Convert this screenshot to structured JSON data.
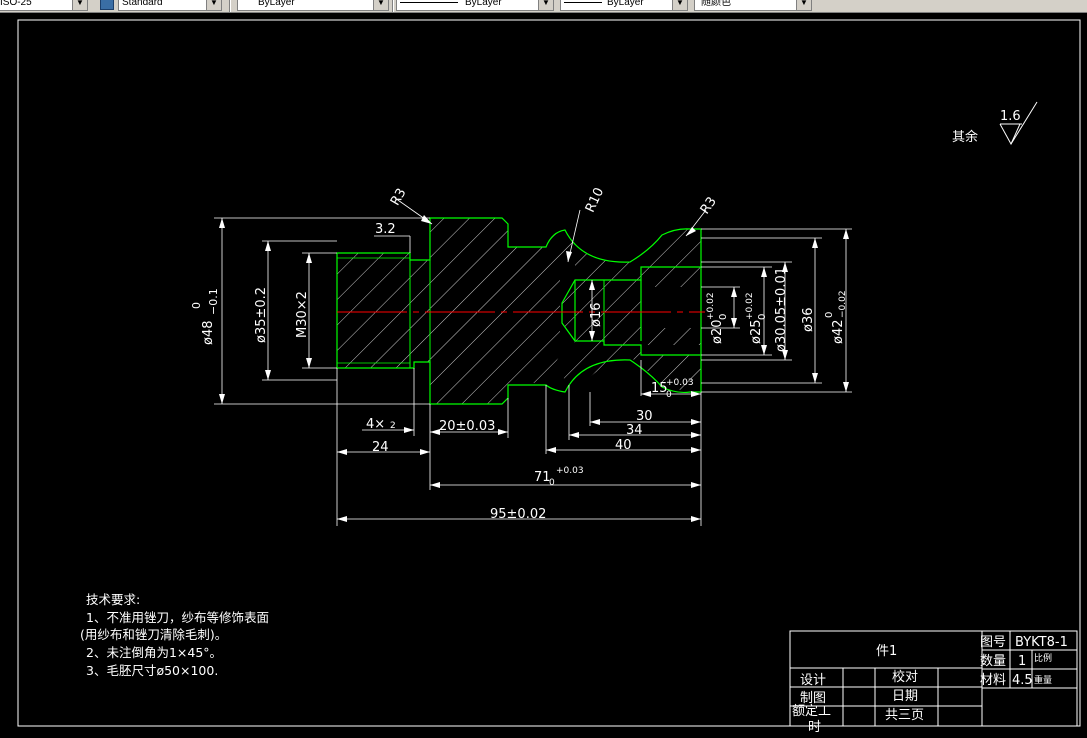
{
  "toolbar": {
    "dimstyle": "ISO-25",
    "textstyle": "Standard",
    "layer": "ByLayer",
    "linetype": "ByLayer",
    "lineweight": "ByLayer",
    "plotstyle": "随颜色"
  },
  "roughness": {
    "prefix": "其余",
    "value": "1.6"
  },
  "dimensions": {
    "r3a": "R3",
    "r10": "R10",
    "r3b": "R3",
    "r3_2": "3.2",
    "d48": "ø48",
    "d48_up": "0",
    "d48_low": "−0.1",
    "d35": "ø35±0.2",
    "m30": "M30×2",
    "d16": "ø16",
    "d20": "ø20",
    "d20_sub": "0",
    "d20_sup": "+0.02",
    "d25": "ø25",
    "d25_sub": "0",
    "d25_sup": "+0.02",
    "d30": "ø30.05±0.01",
    "d36": "ø36",
    "d42": "ø42",
    "d42_up": "0",
    "d42_low": "−0.02",
    "len15": "15",
    "len15_sub": "0",
    "len15_sup": "+0.03",
    "len30": "30",
    "len34": "34",
    "len40": "40",
    "groove": "4×",
    "groove_sub": "2",
    "len20": "20±0.03",
    "len24": "24",
    "len71": "71",
    "len71_sub": "0",
    "len71_sup": "+0.03",
    "len95": "95±0.02"
  },
  "tech": {
    "title": "技术要求:",
    "line1": "1、不准用锉刀，纱布等修饰表面",
    "line2": "(用纱布和锉刀清除毛刺)。",
    "line3": "2、未注倒角为1×45°。",
    "line4": "3、毛胚尺寸ø50×100."
  },
  "titleblock": {
    "part": "件1",
    "tuhao_label": "图号",
    "tuhao_value": "BYKT8-1",
    "qty_label": "数量",
    "qty_value": "1",
    "scale_label": "比例",
    "material_label": "材料",
    "material_value": "4.5",
    "weight_label": "重量",
    "design": "设计",
    "check": "校对",
    "draw": "制图",
    "date": "日期",
    "quota1": "额定工",
    "quota2": "时",
    "pages": "共三页"
  },
  "colors": {
    "outline": "#00ff00",
    "centerline": "#ff0000",
    "lines": "#ffffff",
    "background": "#000000"
  }
}
